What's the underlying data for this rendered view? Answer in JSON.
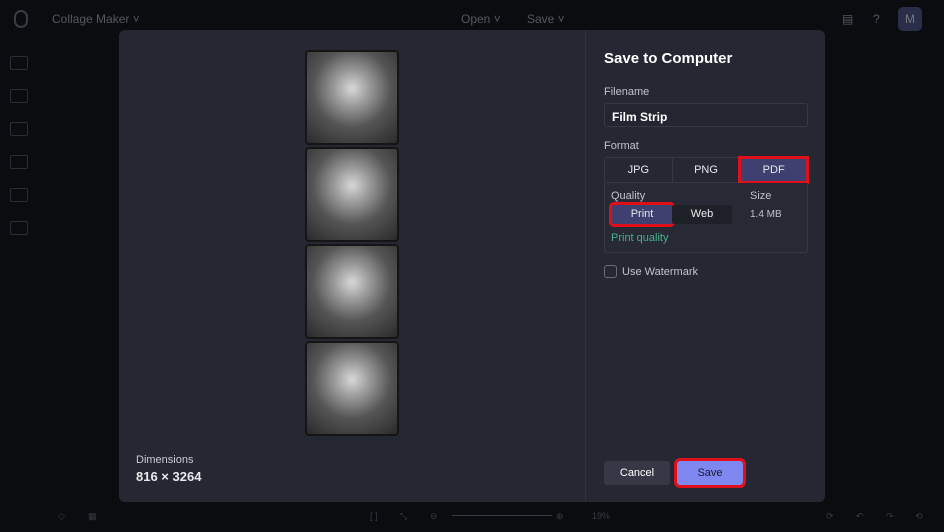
{
  "topbar": {
    "app_title": "Collage Maker ˅",
    "open_label": "Open ˅",
    "save_label": "Save ˅",
    "avatar_initial": "M"
  },
  "dialog": {
    "title": "Save to Computer",
    "filename_label": "Filename",
    "filename_value": "Film Strip",
    "format_label": "Format",
    "formats": [
      "JPG",
      "PNG",
      "PDF"
    ],
    "quality_label": "Quality",
    "qualities": [
      "Print",
      "Web"
    ],
    "size_label": "Size",
    "size_value": "1.4 MB",
    "quality_note": "Print quality",
    "watermark_label": "Use Watermark",
    "cancel_label": "Cancel",
    "save_label": "Save",
    "dimensions_label": "Dimensions",
    "dimensions_value": "816 × 3264"
  },
  "bottombar": {
    "zoom": "19%"
  }
}
